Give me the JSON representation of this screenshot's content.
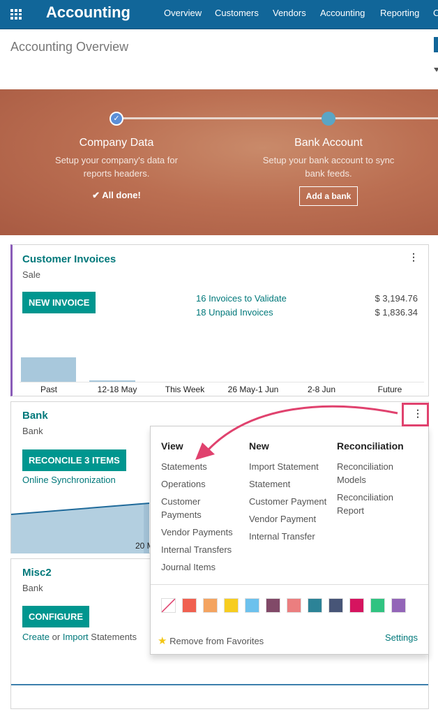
{
  "navbar": {
    "app_title": "Accounting",
    "menu": [
      "Overview",
      "Customers",
      "Vendors",
      "Accounting",
      "Reporting",
      "C"
    ]
  },
  "control_panel": {
    "title": "Accounting Overview"
  },
  "onboarding": {
    "steps": [
      {
        "title": "Company Data",
        "description": "Setup your company's data for reports headers.",
        "status": "All done!",
        "done": true
      },
      {
        "title": "Bank Account",
        "description": "Setup your bank account to sync bank feeds.",
        "button": "Add a bank",
        "done": false
      }
    ]
  },
  "cards": {
    "customer_invoices": {
      "title": "Customer Invoices",
      "subtitle": "Sale",
      "button": "NEW INVOICE",
      "stats": [
        {
          "label": "16 Invoices to Validate",
          "amount": "$ 3,194.76"
        },
        {
          "label": "18 Unpaid Invoices",
          "amount": "$ 1,836.34"
        }
      ],
      "chart_labels": [
        "Past",
        "12-18 May",
        "This Week",
        "26 May-1 Jun",
        "2-8 Jun",
        "Future"
      ]
    },
    "bank": {
      "title": "Bank",
      "subtitle": "Bank",
      "button": "RECONCILE 3 ITEMS",
      "link": "Online Synchronization",
      "chart_label": "20 M"
    },
    "misc2": {
      "title": "Misc2",
      "subtitle": "Bank",
      "button": "CONFIGURE",
      "link_create": "Create",
      "link_or": " or ",
      "link_import": "Import",
      "link_statements": " Statements"
    }
  },
  "dropdown": {
    "view": {
      "header": "View",
      "items": [
        "Statements",
        "Operations",
        "Customer Payments",
        "Vendor Payments",
        "Internal Transfers",
        "Journal Items"
      ]
    },
    "new": {
      "header": "New",
      "items": [
        "Import Statement",
        "Statement",
        "Customer Payment",
        "Vendor Payment",
        "Internal Transfer"
      ]
    },
    "reconciliation": {
      "header": "Reconciliation",
      "items": [
        "Reconciliation Models",
        "Reconciliation Report"
      ]
    },
    "colors": [
      "#f06050",
      "#f4a460",
      "#f7cd1f",
      "#6cc1ed",
      "#814968",
      "#eb7e7f",
      "#2c8397",
      "#475577",
      "#d6145f",
      "#30c381",
      "#9365b8"
    ],
    "favorite": "Remove from Favorites",
    "settings": "Settings"
  },
  "annotation": {
    "highlight_color": "#e0426e"
  }
}
